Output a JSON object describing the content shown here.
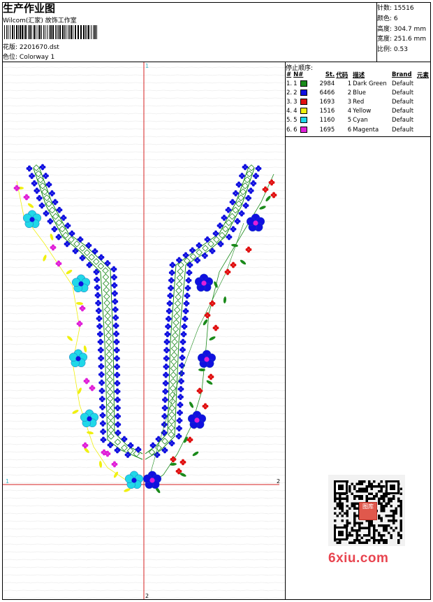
{
  "header": {
    "title": "生产作业图",
    "company": "Wilcom(汇家) 故饰工作室",
    "design_label": "花版:",
    "design_value": "2201670.dst",
    "colorway_label": "色位:",
    "colorway_value": "Colorway 1"
  },
  "specs": [
    {
      "label": "针数:",
      "value": "15516"
    },
    {
      "label": "颜色:",
      "value": "6"
    },
    {
      "label": "高度:",
      "value": "304.7 mm"
    },
    {
      "label": "宽度:",
      "value": "251.6 mm"
    },
    {
      "label": "比例:",
      "value": "0.53"
    }
  ],
  "stop_sequence": {
    "title": "停止顺序:",
    "columns": [
      "#",
      "N#",
      "St.",
      "代码",
      "描述",
      "Brand",
      "元素"
    ],
    "rows": [
      {
        "idx": "1.",
        "n": "1",
        "color": "#1a8a1a",
        "st": "2984",
        "code": "1",
        "desc": "Dark Green",
        "brand": "Default"
      },
      {
        "idx": "2.",
        "n": "2",
        "color": "#1010e0",
        "st": "6466",
        "code": "2",
        "desc": "Blue",
        "brand": "Default"
      },
      {
        "idx": "3.",
        "n": "3",
        "color": "#e01010",
        "st": "1693",
        "code": "3",
        "desc": "Red",
        "brand": "Default"
      },
      {
        "idx": "4.",
        "n": "4",
        "color": "#f0f010",
        "st": "1516",
        "code": "4",
        "desc": "Yellow",
        "brand": "Default"
      },
      {
        "idx": "5.",
        "n": "5",
        "color": "#20d8e8",
        "st": "1160",
        "code": "5",
        "desc": "Cyan",
        "brand": "Default"
      },
      {
        "idx": "6.",
        "n": "6",
        "color": "#e020d8",
        "st": "1695",
        "code": "6",
        "desc": "Magenta",
        "brand": "Default"
      }
    ]
  },
  "axis_labels": {
    "top": "1",
    "bottom": "2",
    "left": "1",
    "right": "2"
  },
  "qr_seal_text": "图库",
  "watermark": "6xiu.com",
  "colors": {
    "dark_green": "#1a8a1a",
    "blue": "#1010e0",
    "red": "#e01010",
    "yellow": "#f0f010",
    "cyan": "#20d8e8",
    "magenta": "#e020d8",
    "axis": "#d42020"
  }
}
